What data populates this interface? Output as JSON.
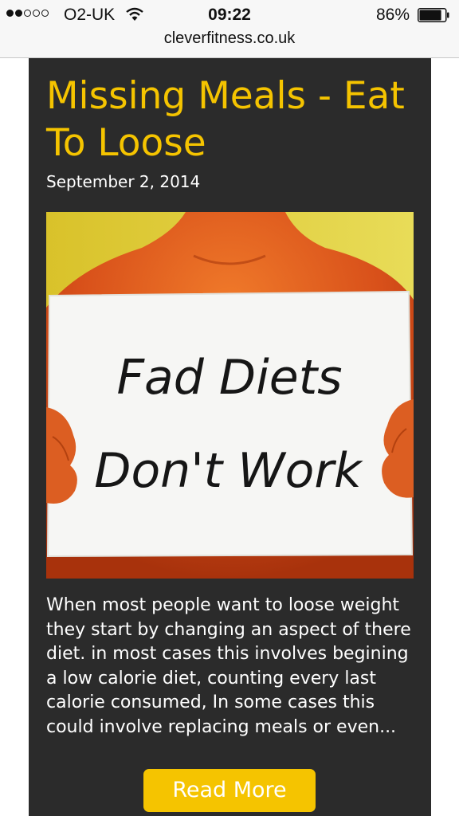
{
  "status_bar": {
    "carrier": "O2-UK",
    "time": "09:22",
    "battery_percent": "86%",
    "signal_bars_filled": 2,
    "signal_bars_total": 5,
    "battery_level": 0.86
  },
  "browser": {
    "url": "cleverfitness.co.uk"
  },
  "post": {
    "title": "Missing Meals - Eat To Loose",
    "date": "September 2, 2014",
    "image": {
      "sign_line1": "Fad Diets",
      "sign_line2": "Don't Work"
    },
    "excerpt": "When most people want to loose weight they start by changing an aspect of there diet. in most cases this involves begining a low calorie diet, counting every last calorie consumed, In some cases this could involve replacing meals or even...",
    "read_more_label": "Read More"
  },
  "colors": {
    "accent": "#f5c400",
    "card_background": "#2b2b2b",
    "text": "#ffffff"
  }
}
